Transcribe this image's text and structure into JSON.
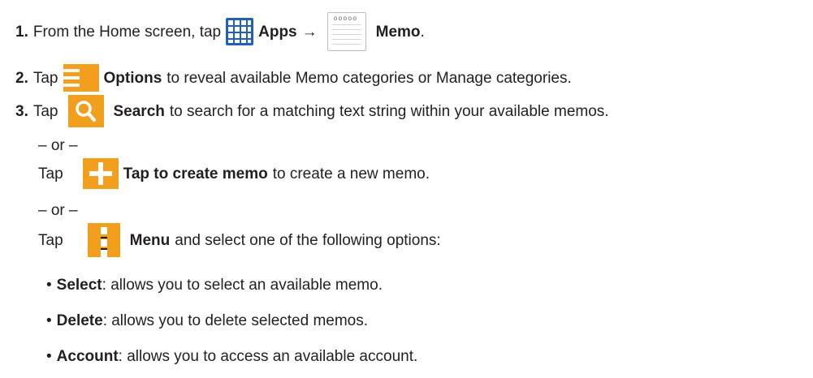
{
  "steps": [
    {
      "number": "1.",
      "text_before": "From the Home screen, tap",
      "apps_label": "Apps",
      "arrow": "→",
      "memo_label": "Memo",
      "end": ".",
      "icons": [
        "apps-grid-icon",
        "memo-notepad-icon"
      ]
    },
    {
      "number": "2.",
      "tap": "Tap",
      "label": "Options",
      "text_after": "to reveal available Memo categories or Manage categories.",
      "icon": "options-lines-icon"
    },
    {
      "number": "3.",
      "tap": "Tap",
      "label": "Search",
      "text_after": "to search for a matching text string within your available memos.",
      "icon": "search-magnifier-icon"
    }
  ],
  "or_separator": "– or –",
  "alt_create": {
    "tap": "Tap",
    "label": "Tap to create memo",
    "text_after": "to create a new memo.",
    "icon": "plus-icon"
  },
  "alt_menu": {
    "tap": "Tap",
    "label": "Menu",
    "text_after": "and select one of the following options:",
    "icon": "menu-dots-icon"
  },
  "options": [
    {
      "bullet": "•",
      "name": "Select",
      "desc": ": allows you to select an available memo."
    },
    {
      "bullet": "•",
      "name": "Delete",
      "desc": ": allows you to delete selected memos."
    },
    {
      "bullet": "•",
      "name": "Account",
      "desc": ": allows you to access an available account."
    }
  ],
  "colors": {
    "text": "#231f20",
    "apps_icon_blue": "#1f62b8",
    "icon_orange": "#f29f1e"
  }
}
